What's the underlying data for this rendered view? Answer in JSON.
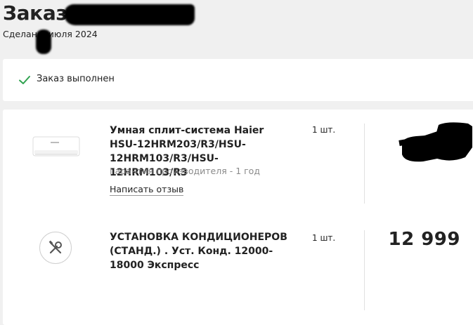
{
  "header": {
    "title": "Заказ",
    "date_text": "Сделан 1 июля 2024"
  },
  "status": {
    "icon": "check-icon",
    "text": "Заказ выполнен",
    "color": "#2fa24f"
  },
  "items": [
    {
      "image": "air-conditioner-image",
      "title": "Умная сплит-система Haier HSU-12HRM203/R3/HSU-12HRM103/R3/HSU-12HRM103/R3",
      "warranty": "Гарантия производителя - 1 год",
      "review_label": "Написать отзыв",
      "qty": "1 шт.",
      "price": ""
    },
    {
      "image": "tools-icon",
      "title": "УСТАНОВКА КОНДИЦИОНЕРОВ (СТАНД.) . Уст. Конд. 12000-18000 Экспресс",
      "qty": "1 шт.",
      "price": "12 999"
    }
  ]
}
